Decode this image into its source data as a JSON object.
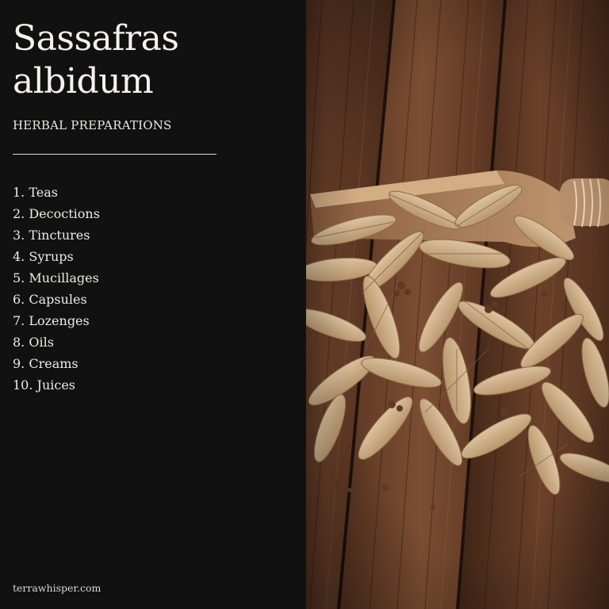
{
  "title_line1": "Sassafras",
  "title_line2": "albidum",
  "subtitle": "HERBAL PREPARATIONS",
  "preparations": [
    "1. Teas",
    "2. Decoctions",
    "3. Tinctures",
    "4. Syrups",
    "5. Mucillages",
    "6. Capsules",
    "7. Lozenges",
    "8. Oils",
    "9. Creams",
    "10. Juices"
  ],
  "footer": "terrawhisper.com",
  "colors": {
    "panel": "#111111",
    "text": "#f2f0ec",
    "wood": "#5a3420",
    "leaf": "#c9ad86"
  }
}
